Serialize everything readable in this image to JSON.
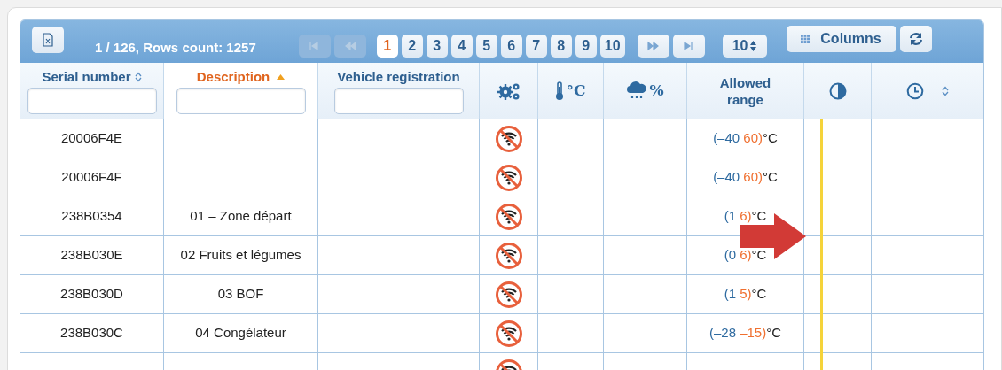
{
  "toolbar": {
    "summary": "1 / 126, Rows count: 1257",
    "pager": {
      "first_disabled": true,
      "prev_disabled": true,
      "pages": [
        {
          "label": "1",
          "selected": true
        },
        {
          "label": "2",
          "selected": false
        },
        {
          "label": "3",
          "selected": false
        },
        {
          "label": "4",
          "selected": false
        },
        {
          "label": "5",
          "selected": false
        },
        {
          "label": "6",
          "selected": false
        },
        {
          "label": "7",
          "selected": false
        },
        {
          "label": "8",
          "selected": false
        },
        {
          "label": "9",
          "selected": false
        },
        {
          "label": "10",
          "selected": false
        }
      ],
      "next_disabled": false,
      "last_disabled": false
    },
    "page_size": "10",
    "columns_button": "Columns"
  },
  "columns": [
    {
      "kind": "text",
      "label": "Serial number",
      "sortable": true,
      "sorted_ascending": false,
      "filter": true
    },
    {
      "kind": "text",
      "label": "Description",
      "sortable": true,
      "sorted_ascending": true,
      "filter": true
    },
    {
      "kind": "text",
      "label": "Vehicle registration",
      "sortable": false,
      "sorted_ascending": false,
      "filter": true
    },
    {
      "kind": "gears"
    },
    {
      "kind": "thermometer",
      "suffix": "°C"
    },
    {
      "kind": "humidity",
      "suffix": "%"
    },
    {
      "kind": "text",
      "label": "Allowed range",
      "sortable": false,
      "sorted_ascending": false,
      "filter": false
    },
    {
      "kind": "contrast"
    },
    {
      "kind": "clock",
      "sortable": true,
      "sorted_ascending": false
    }
  ],
  "rows": [
    {
      "serial": "20006F4E",
      "description": "",
      "range": {
        "low": "(–40",
        "high": "60)",
        "unit": "°C"
      }
    },
    {
      "serial": "20006F4F",
      "description": "",
      "range": {
        "low": "(–40",
        "high": "60)",
        "unit": "°C"
      }
    },
    {
      "serial": "238B0354",
      "description": "01 – Zone départ",
      "range": {
        "low": "(1",
        "high": "6)",
        "unit": "°C"
      }
    },
    {
      "serial": "238B030E",
      "description": "02 Fruits et légumes",
      "range": {
        "low": "(0",
        "high": "6)",
        "unit": "°C"
      }
    },
    {
      "serial": "238B030D",
      "description": "03 BOF",
      "range": {
        "low": "(1",
        "high": "5)",
        "unit": "°C"
      }
    },
    {
      "serial": "238B030C",
      "description": "04 Congélateur",
      "range": {
        "low": "(–28",
        "high": "–15)",
        "unit": "°C"
      }
    },
    {}
  ]
}
